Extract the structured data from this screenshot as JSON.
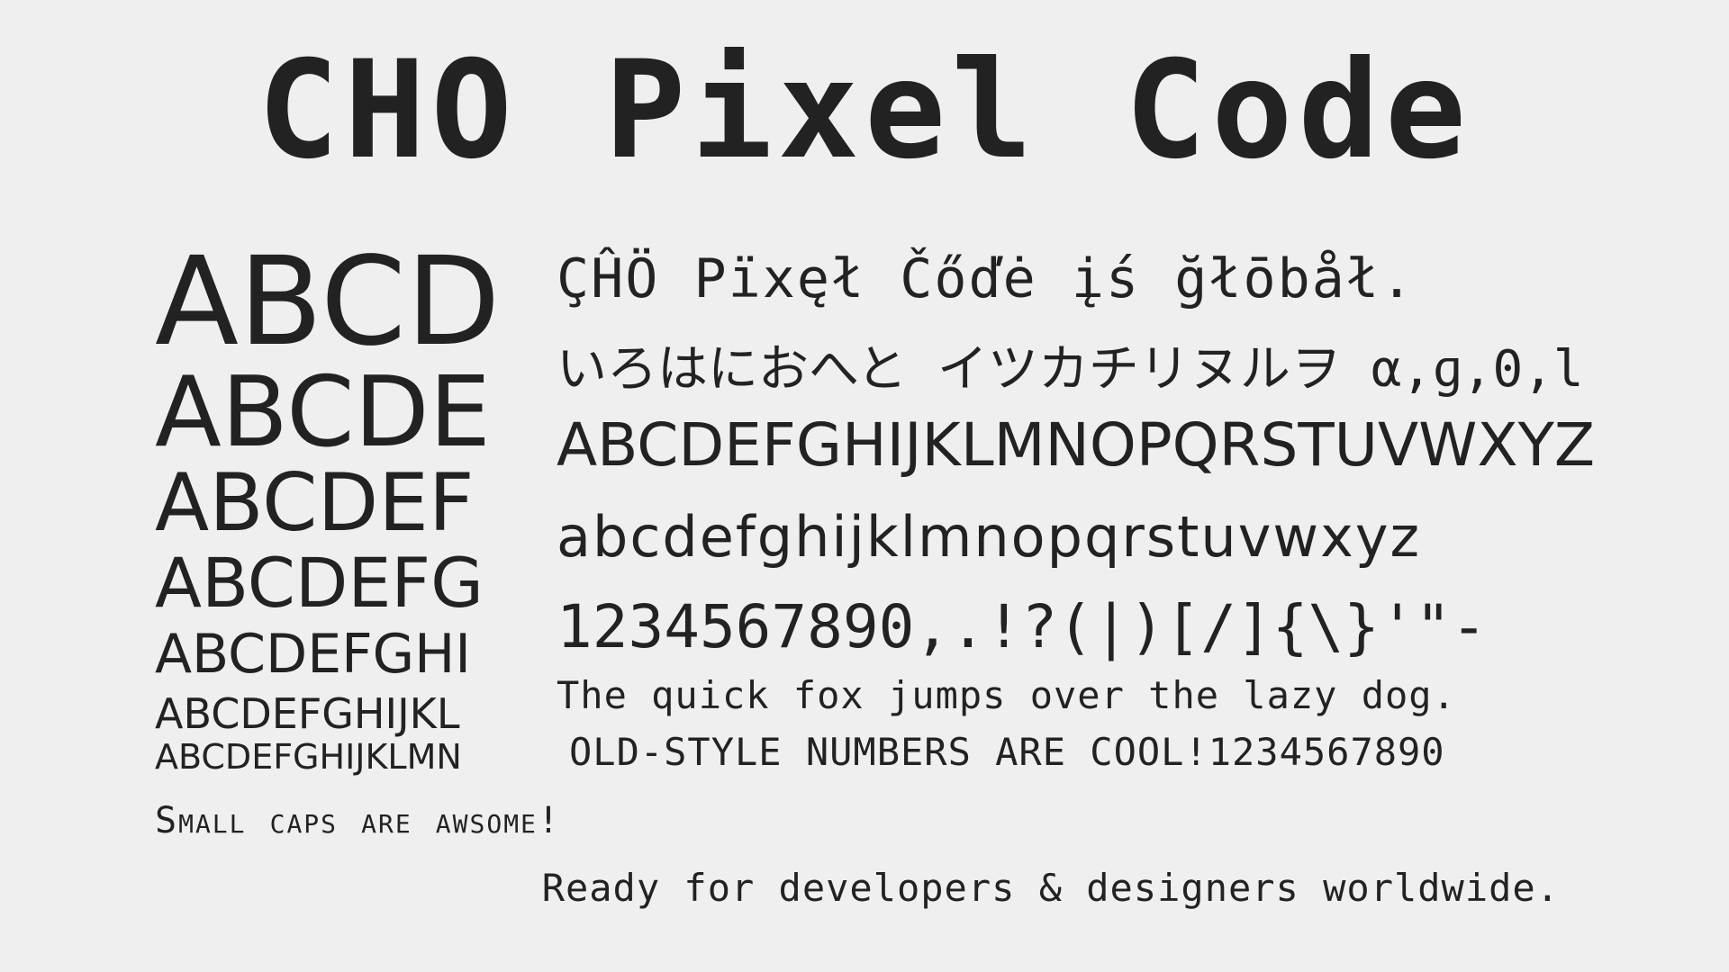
{
  "colors": {
    "background": "#efefef",
    "ink": "#222222"
  },
  "title": "CHO Pixel Code",
  "size_ramp": [
    "ABCD",
    "ABCDE",
    "ABCDEF",
    "ABCDEFG",
    "ABCDEFGHI",
    "ABCDEFGHIJKL",
    "ABCDEFGHIJKLMN"
  ],
  "specimen": {
    "global_line": "ÇĤÖ Pïxęł Čőďė įś ğłōbåł.",
    "kana_line": "いろはにおへと イツカチリヌルヲ α,ɡ,0,l",
    "uppercase": "ABCDEFGHIJKLMNOPQRSTUVWXYZ",
    "lowercase": "abcdefghijklmnopqrstuvwxyz",
    "digits_punct": "1234567890,.!?(|)[/]{\\}'\"-",
    "pangram": "The quick fox jumps over the lazy dog.",
    "oldstyle": "OLD-STYLE NUMBERS ARE COOL!1234567890"
  },
  "small_caps_line": "Small caps are awsome!",
  "tagline": "Ready for developers & designers worldwide."
}
